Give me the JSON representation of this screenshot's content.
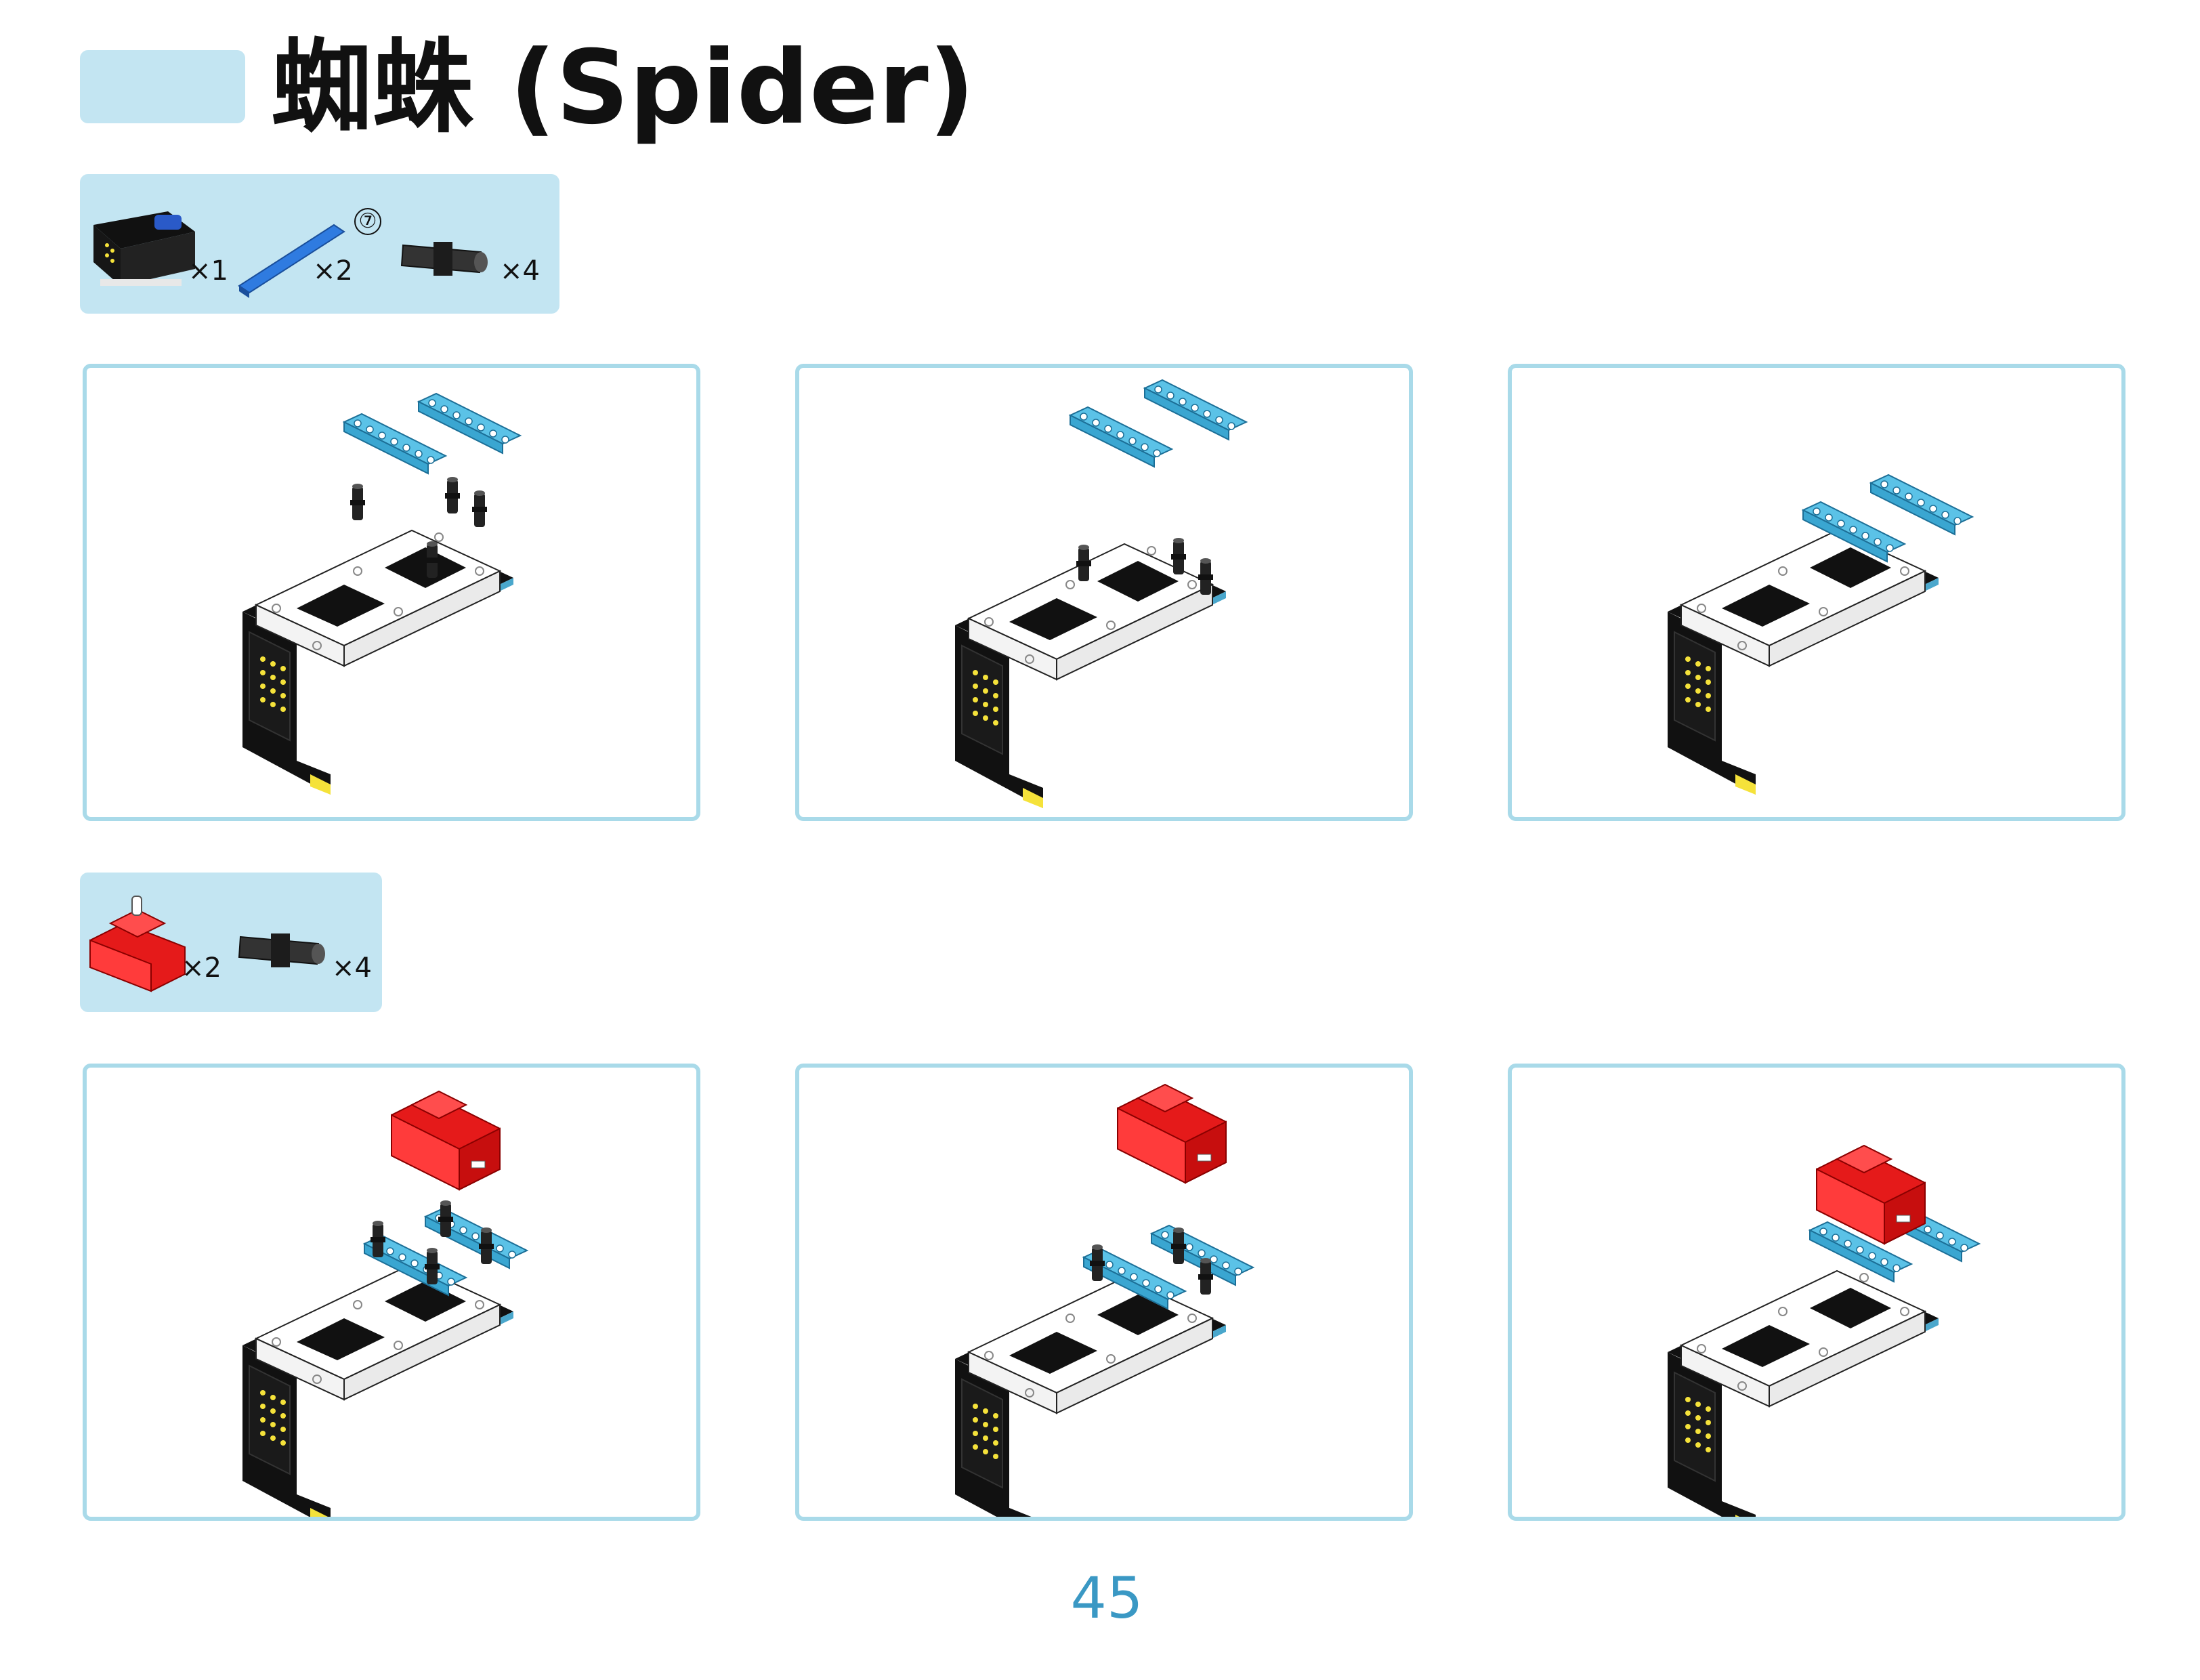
{
  "header": {
    "title": "蜘蛛 (Spider)"
  },
  "parts_list_1": [
    {
      "icon": "microbit-expansion-board-icon",
      "qty": "×1"
    },
    {
      "icon": "blue-beam-icon",
      "qty": "×2",
      "note": "⑦"
    },
    {
      "icon": "black-pin-icon",
      "qty": "×4"
    }
  ],
  "parts_list_2": [
    {
      "icon": "red-servo-icon",
      "qty": "×2"
    },
    {
      "icon": "black-pin-icon",
      "qty": "×4"
    }
  ],
  "steps": [
    {
      "name": "step-1-beams-pins-exploded"
    },
    {
      "name": "step-2-beams-above-pins"
    },
    {
      "name": "step-3-beams-attached"
    },
    {
      "name": "step-4-servo-pins-exploded"
    },
    {
      "name": "step-5-servo-above"
    },
    {
      "name": "step-6-servo-attached"
    }
  ],
  "footer": {
    "page_number": "45"
  },
  "colors": {
    "accent": "#c3e5f2",
    "panel_border": "#a9dae9",
    "beam": "#5bc2e7",
    "servo": "#e51a1a",
    "page_number": "#3a98c4"
  }
}
